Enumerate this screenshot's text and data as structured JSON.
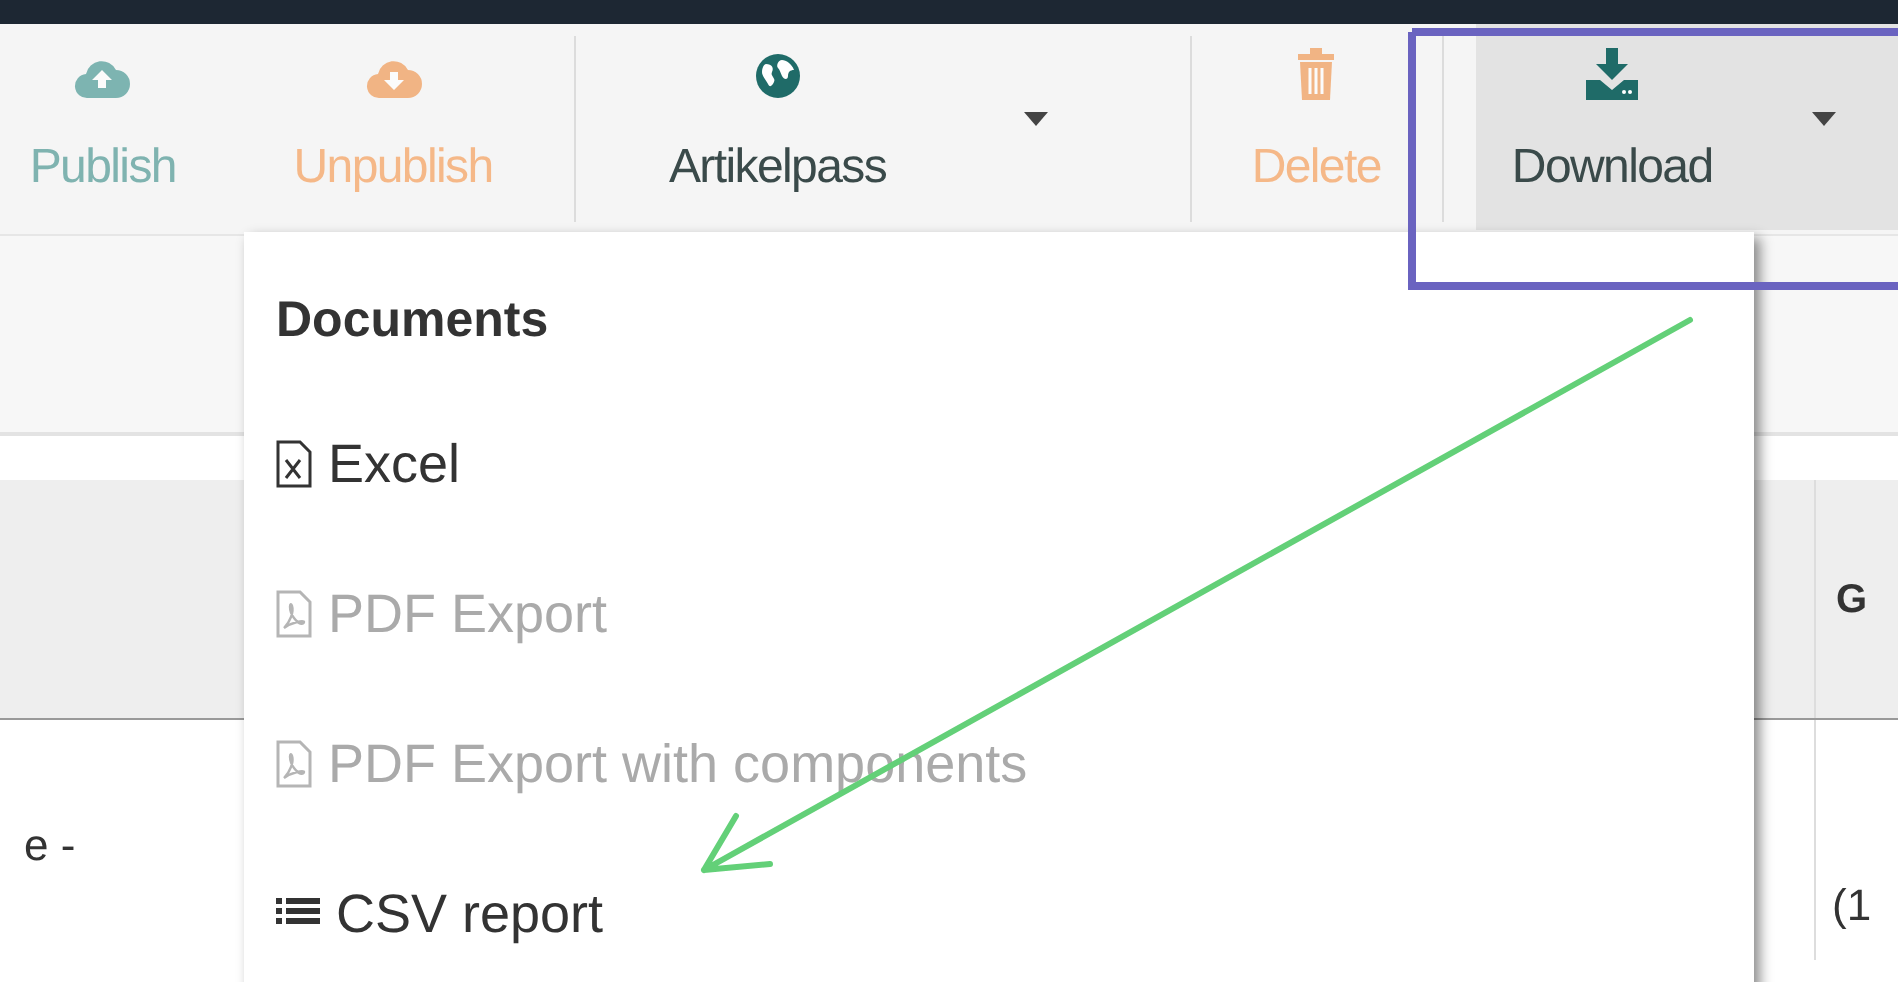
{
  "toolbar": {
    "buttons": [
      {
        "kind": "publish",
        "label": "Publish",
        "disabled": true,
        "selected": false,
        "has_menu": false
      },
      {
        "kind": "unpublish",
        "label": "Unpublish",
        "disabled": true,
        "selected": false,
        "has_menu": false
      },
      {
        "kind": "globe",
        "label": "Artikelpass",
        "disabled": false,
        "selected": false,
        "has_menu": true
      },
      {
        "kind": "delete",
        "label": "Delete",
        "disabled": true,
        "selected": false,
        "has_menu": false
      },
      {
        "kind": "download",
        "label": "Download",
        "disabled": false,
        "selected": true,
        "has_menu": true
      }
    ]
  },
  "table": {
    "header": "G",
    "row": {
      "column_1": "e -",
      "column_2": "(1"
    }
  },
  "menu": {
    "heading": "Documents",
    "items": [
      {
        "kind": "excel",
        "label": "Excel",
        "disabled": false
      },
      {
        "kind": "pdf",
        "label": "PDF Export",
        "disabled": true
      },
      {
        "kind": "pdf",
        "label": "PDF Export with components",
        "disabled": true
      },
      {
        "kind": "list",
        "label": "CSV report",
        "disabled": false
      }
    ]
  }
}
